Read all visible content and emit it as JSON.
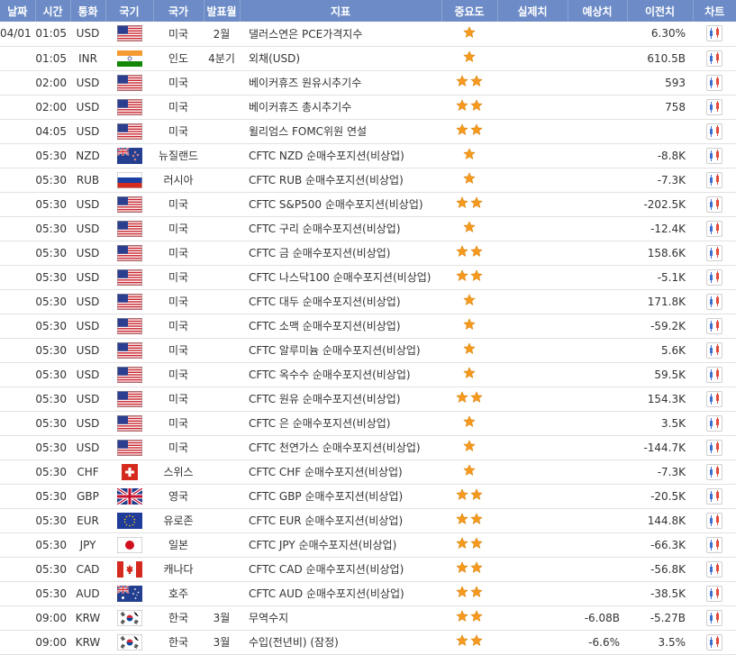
{
  "colors": {
    "header_bg": "#6d8cc7",
    "header_text": "#ffffff",
    "star": "#f59a1e"
  },
  "headers": {
    "date": "날짜",
    "time": "시간",
    "currency": "통화",
    "flag": "국기",
    "country": "국가",
    "period": "발표월",
    "indicator": "지표",
    "importance": "중요도",
    "actual": "실제치",
    "forecast": "예상치",
    "previous": "이전치",
    "chart": "차트"
  },
  "rows": [
    {
      "date": "04/01",
      "time": "01:05",
      "currency": "USD",
      "flag": "us-flag-icon",
      "country": "미국",
      "period": "2월",
      "indicator": "댈러스연은 PCE가격지수",
      "stars": 1,
      "actual": "",
      "forecast": "",
      "previous": "6.30%"
    },
    {
      "date": "",
      "time": "01:05",
      "currency": "INR",
      "flag": "in-flag-icon",
      "country": "인도",
      "period": "4분기",
      "indicator": "외채(USD)",
      "stars": 1,
      "actual": "",
      "forecast": "",
      "previous": "610.5B"
    },
    {
      "date": "",
      "time": "02:00",
      "currency": "USD",
      "flag": "us-flag-icon",
      "country": "미국",
      "period": "",
      "indicator": "베이커휴즈 원유시추기수",
      "stars": 2,
      "actual": "",
      "forecast": "",
      "previous": "593"
    },
    {
      "date": "",
      "time": "02:00",
      "currency": "USD",
      "flag": "us-flag-icon",
      "country": "미국",
      "period": "",
      "indicator": "베이커휴즈 총시추기수",
      "stars": 2,
      "actual": "",
      "forecast": "",
      "previous": "758"
    },
    {
      "date": "",
      "time": "04:05",
      "currency": "USD",
      "flag": "us-flag-icon",
      "country": "미국",
      "period": "",
      "indicator": "윌리엄스 FOMC위원 연설",
      "stars": 2,
      "actual": "",
      "forecast": "",
      "previous": ""
    },
    {
      "date": "",
      "time": "05:30",
      "currency": "NZD",
      "flag": "nz-flag-icon",
      "country": "뉴질랜드",
      "period": "",
      "indicator": "CFTC NZD 순매수포지션(비상업)",
      "stars": 1,
      "actual": "",
      "forecast": "",
      "previous": "-8.8K"
    },
    {
      "date": "",
      "time": "05:30",
      "currency": "RUB",
      "flag": "ru-flag-icon",
      "country": "러시아",
      "period": "",
      "indicator": "CFTC RUB 순매수포지션(비상업)",
      "stars": 1,
      "actual": "",
      "forecast": "",
      "previous": "-7.3K"
    },
    {
      "date": "",
      "time": "05:30",
      "currency": "USD",
      "flag": "us-flag-icon",
      "country": "미국",
      "period": "",
      "indicator": "CFTC S&P500 순매수포지션(비상업)",
      "stars": 2,
      "actual": "",
      "forecast": "",
      "previous": "-202.5K"
    },
    {
      "date": "",
      "time": "05:30",
      "currency": "USD",
      "flag": "us-flag-icon",
      "country": "미국",
      "period": "",
      "indicator": "CFTC 구리 순매수포지션(비상업)",
      "stars": 1,
      "actual": "",
      "forecast": "",
      "previous": "-12.4K"
    },
    {
      "date": "",
      "time": "05:30",
      "currency": "USD",
      "flag": "us-flag-icon",
      "country": "미국",
      "period": "",
      "indicator": "CFTC 금 순매수포지션(비상업)",
      "stars": 2,
      "actual": "",
      "forecast": "",
      "previous": "158.6K"
    },
    {
      "date": "",
      "time": "05:30",
      "currency": "USD",
      "flag": "us-flag-icon",
      "country": "미국",
      "period": "",
      "indicator": "CFTC 나스닥100 순매수포지션(비상업)",
      "stars": 2,
      "actual": "",
      "forecast": "",
      "previous": "-5.1K"
    },
    {
      "date": "",
      "time": "05:30",
      "currency": "USD",
      "flag": "us-flag-icon",
      "country": "미국",
      "period": "",
      "indicator": "CFTC 대두 순매수포지션(비상업)",
      "stars": 1,
      "actual": "",
      "forecast": "",
      "previous": "171.8K"
    },
    {
      "date": "",
      "time": "05:30",
      "currency": "USD",
      "flag": "us-flag-icon",
      "country": "미국",
      "period": "",
      "indicator": "CFTC 소맥 순매수포지션(비상업)",
      "stars": 1,
      "actual": "",
      "forecast": "",
      "previous": "-59.2K"
    },
    {
      "date": "",
      "time": "05:30",
      "currency": "USD",
      "flag": "us-flag-icon",
      "country": "미국",
      "period": "",
      "indicator": "CFTC 알루미늄 순매수포지션(비상업)",
      "stars": 1,
      "actual": "",
      "forecast": "",
      "previous": "5.6K"
    },
    {
      "date": "",
      "time": "05:30",
      "currency": "USD",
      "flag": "us-flag-icon",
      "country": "미국",
      "period": "",
      "indicator": "CFTC 옥수수 순매수포지션(비상업)",
      "stars": 1,
      "actual": "",
      "forecast": "",
      "previous": "59.5K"
    },
    {
      "date": "",
      "time": "05:30",
      "currency": "USD",
      "flag": "us-flag-icon",
      "country": "미국",
      "period": "",
      "indicator": "CFTC 원유 순매수포지션(비상업)",
      "stars": 2,
      "actual": "",
      "forecast": "",
      "previous": "154.3K"
    },
    {
      "date": "",
      "time": "05:30",
      "currency": "USD",
      "flag": "us-flag-icon",
      "country": "미국",
      "period": "",
      "indicator": "CFTC 은 순매수포지션(비상업)",
      "stars": 1,
      "actual": "",
      "forecast": "",
      "previous": "3.5K"
    },
    {
      "date": "",
      "time": "05:30",
      "currency": "USD",
      "flag": "us-flag-icon",
      "country": "미국",
      "period": "",
      "indicator": "CFTC 천연가스 순매수포지션(비상업)",
      "stars": 1,
      "actual": "",
      "forecast": "",
      "previous": "-144.7K"
    },
    {
      "date": "",
      "time": "05:30",
      "currency": "CHF",
      "flag": "ch-flag-icon",
      "country": "스위스",
      "period": "",
      "indicator": "CFTC CHF 순매수포지션(비상업)",
      "stars": 1,
      "actual": "",
      "forecast": "",
      "previous": "-7.3K"
    },
    {
      "date": "",
      "time": "05:30",
      "currency": "GBP",
      "flag": "gb-flag-icon",
      "country": "영국",
      "period": "",
      "indicator": "CFTC GBP 순매수포지션(비상업)",
      "stars": 2,
      "actual": "",
      "forecast": "",
      "previous": "-20.5K"
    },
    {
      "date": "",
      "time": "05:30",
      "currency": "EUR",
      "flag": "eu-flag-icon",
      "country": "유로존",
      "period": "",
      "indicator": "CFTC EUR 순매수포지션(비상업)",
      "stars": 2,
      "actual": "",
      "forecast": "",
      "previous": "144.8K"
    },
    {
      "date": "",
      "time": "05:30",
      "currency": "JPY",
      "flag": "jp-flag-icon",
      "country": "일본",
      "period": "",
      "indicator": "CFTC JPY 순매수포지션(비상업)",
      "stars": 2,
      "actual": "",
      "forecast": "",
      "previous": "-66.3K"
    },
    {
      "date": "",
      "time": "05:30",
      "currency": "CAD",
      "flag": "ca-flag-icon",
      "country": "캐나다",
      "period": "",
      "indicator": "CFTC CAD 순매수포지션(비상업)",
      "stars": 2,
      "actual": "",
      "forecast": "",
      "previous": "-56.8K"
    },
    {
      "date": "",
      "time": "05:30",
      "currency": "AUD",
      "flag": "au-flag-icon",
      "country": "호주",
      "period": "",
      "indicator": "CFTC AUD 순매수포지션(비상업)",
      "stars": 2,
      "actual": "",
      "forecast": "",
      "previous": "-38.5K"
    },
    {
      "date": "",
      "time": "09:00",
      "currency": "KRW",
      "flag": "kr-flag-icon",
      "country": "한국",
      "period": "3월",
      "indicator": "무역수지",
      "stars": 2,
      "actual": "",
      "forecast": "-6.08B",
      "previous": "-5.27B"
    },
    {
      "date": "",
      "time": "09:00",
      "currency": "KRW",
      "flag": "kr-flag-icon",
      "country": "한국",
      "period": "3월",
      "indicator": "수입(전년비) (잠정)",
      "stars": 2,
      "actual": "",
      "forecast": "-6.6%",
      "previous": "3.5%"
    }
  ]
}
